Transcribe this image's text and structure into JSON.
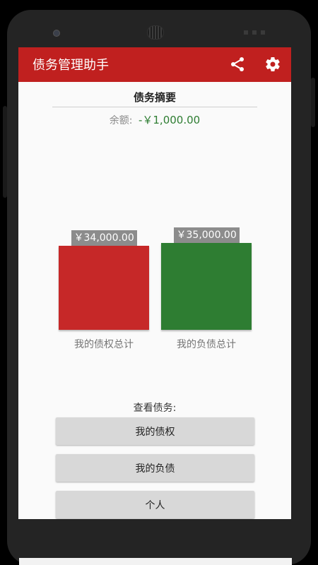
{
  "colors": {
    "appbar": "#c0201f",
    "credit_bar": "#c62828",
    "debt_bar": "#2e7d32",
    "balance_value": "#2e7d32"
  },
  "appbar": {
    "title": "债务管理助手",
    "share_icon": "share-icon",
    "settings_icon": "gear-icon"
  },
  "summary": {
    "title": "债务摘要",
    "balance_label": "余额:",
    "balance_value": "-￥1,000.00"
  },
  "chart_data": {
    "type": "bar",
    "categories": [
      "我的债权总计",
      "我的负债总计"
    ],
    "values": [
      34000,
      35000
    ],
    "value_labels": [
      "￥34,000.00",
      "￥35,000.00"
    ],
    "colors": [
      "#c62828",
      "#2e7d32"
    ],
    "ylim": [
      0,
      35000
    ]
  },
  "view": {
    "label": "查看债务:",
    "buttons": [
      "我的债权",
      "我的负债",
      "个人"
    ]
  }
}
